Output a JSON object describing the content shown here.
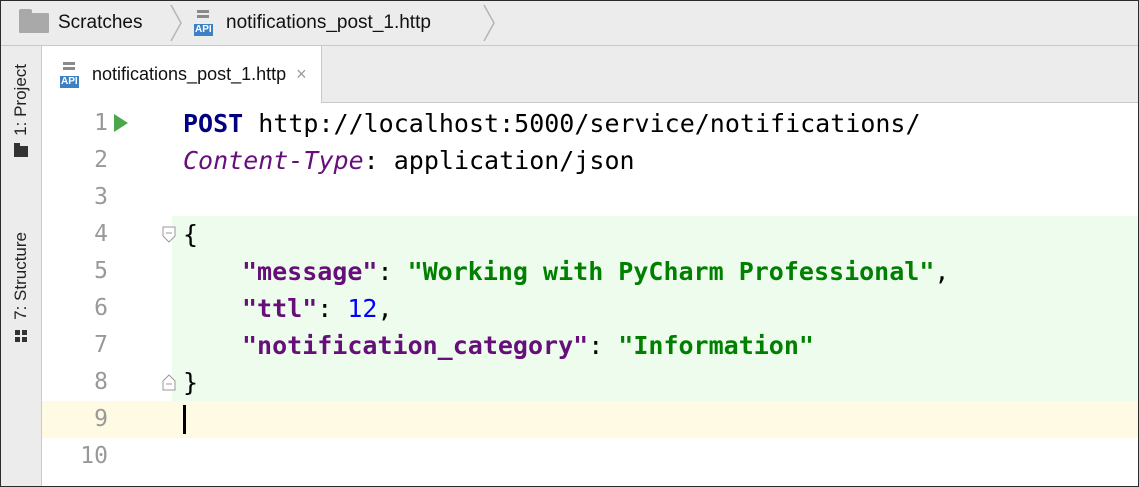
{
  "breadcrumb": {
    "root": "Scratches",
    "file": "notifications_post_1.http",
    "file_icon_text": "API"
  },
  "tool_windows": [
    {
      "label": "1: Project",
      "icon": "folder-icon"
    },
    {
      "label": "7: Structure",
      "icon": "structure-icon"
    }
  ],
  "tab": {
    "label": "notifications_post_1.http",
    "close": "×"
  },
  "editor": {
    "line_numbers": [
      "1",
      "2",
      "3",
      "4",
      "5",
      "6",
      "7",
      "8",
      "9",
      "10"
    ],
    "request": {
      "method": "POST",
      "url": " http://localhost:5000/service/notifications/"
    },
    "header": {
      "name": "Content-Type",
      "sep": ": ",
      "value": "application/json"
    },
    "body": {
      "open": "{",
      "close": "}",
      "message_key": "\"message\"",
      "message_value": "\"Working with PyCharm Professional\"",
      "ttl_key": "\"ttl\"",
      "ttl_value": "12",
      "category_key": "\"notification_category\"",
      "category_value": "\"Information\"",
      "colon": ": ",
      "comma": ","
    }
  },
  "colors": {
    "keyword": "#000080",
    "header_name": "#660e7a",
    "json_key": "#660e7a",
    "json_string": "#007f00",
    "json_number": "#0000ff",
    "json_block_bg": "#edfcec",
    "current_line_bg": "#fffae3",
    "run_icon": "#4aa84a"
  }
}
